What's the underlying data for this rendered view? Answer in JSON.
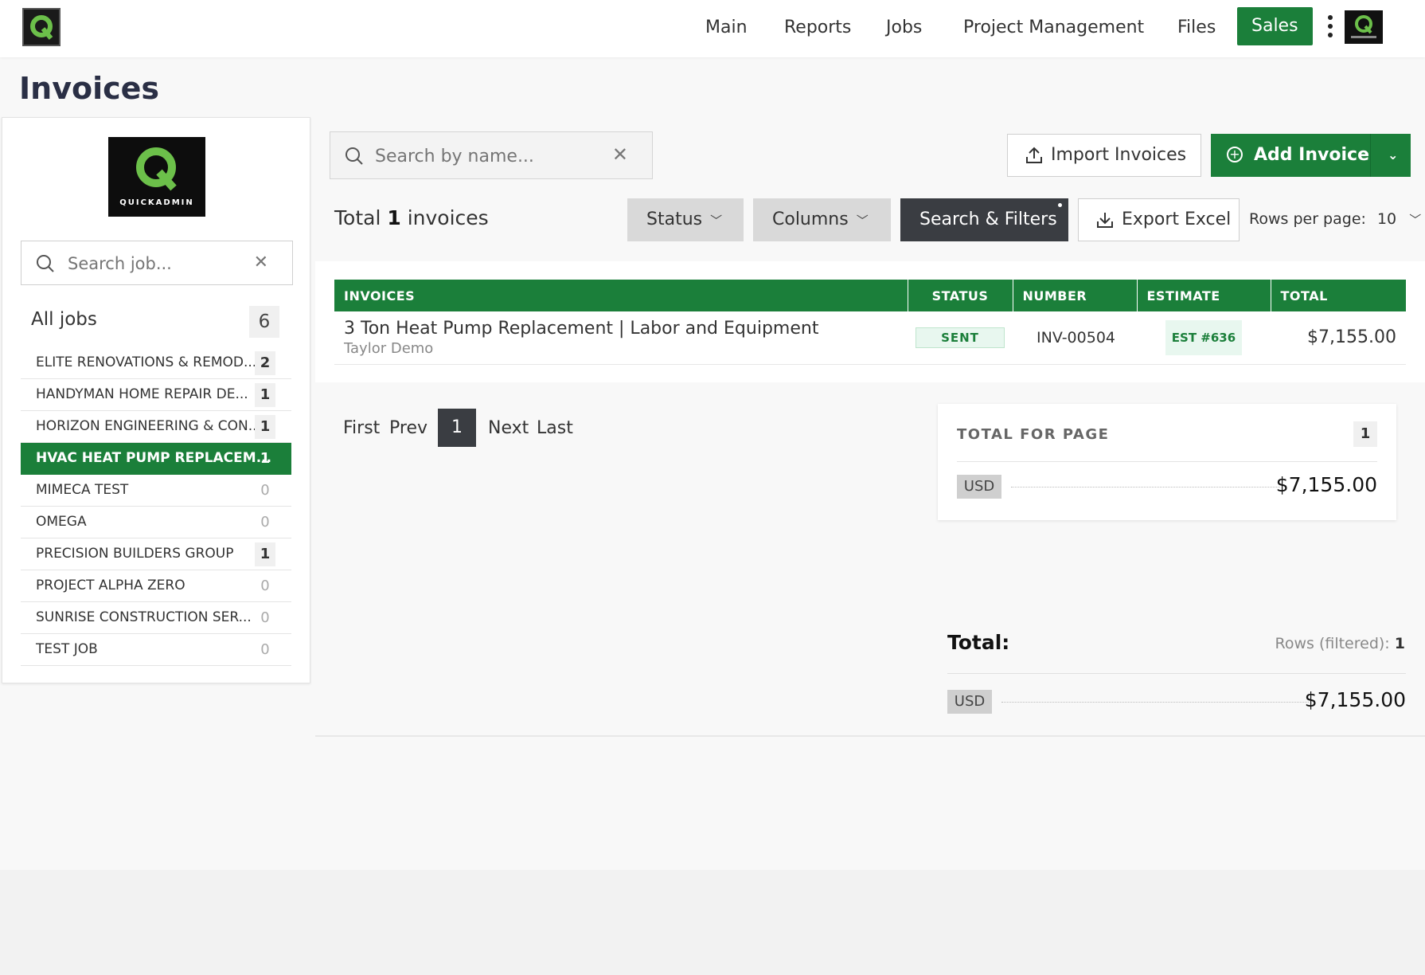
{
  "nav": {
    "items": [
      "Main",
      "Reports",
      "Jobs",
      "Project Management",
      "Files"
    ],
    "sales": "Sales"
  },
  "brand": {
    "name": "QUICKADMIN",
    "accent": "#1b7f3a",
    "logo_green": "#6cc04a"
  },
  "page_title": "Invoices",
  "sidebar": {
    "search_placeholder": "Search job...",
    "all_jobs_label": "All jobs",
    "all_jobs_count": "6",
    "jobs": [
      {
        "name": "ELITE RENOVATIONS & REMOD...",
        "count": "2"
      },
      {
        "name": "HANDYMAN HOME REPAIR DE...",
        "count": "1"
      },
      {
        "name": "HORIZON ENGINEERING & CON...",
        "count": "1"
      },
      {
        "name": "HVAC HEAT PUMP REPLACEM...",
        "count": "1"
      },
      {
        "name": "MIMECA TEST",
        "count": "0"
      },
      {
        "name": "OMEGA",
        "count": "0"
      },
      {
        "name": "PRECISION BUILDERS GROUP",
        "count": "1"
      },
      {
        "name": "PROJECT ALPHA ZERO",
        "count": "0"
      },
      {
        "name": "SUNRISE CONSTRUCTION SER...",
        "count": "0"
      },
      {
        "name": "TEST JOB",
        "count": "0"
      }
    ],
    "active_job": "HVAC HEAT PUMP REPLACEM..."
  },
  "toolbar": {
    "search_placeholder": "Search by name...",
    "import_label": "Import Invoices",
    "add_label": "Add Invoice",
    "total_prefix": "Total",
    "total_count": "1",
    "total_suffix": "invoices",
    "status_label": "Status",
    "columns_label": "Columns",
    "filters_label": "Search & Filters",
    "export_label": "Export Excel",
    "rows_per_page_label": "Rows per page:",
    "rows_per_page_value": "10"
  },
  "table": {
    "headers": [
      "INVOICES",
      "STATUS",
      "NUMBER",
      "ESTIMATE",
      "TOTAL"
    ],
    "rows": [
      {
        "title": "3 Ton Heat Pump Replacement | Labor and Equipment",
        "client": "Taylor Demo",
        "status": "SENT",
        "number": "INV-00504",
        "estimate": "EST #636",
        "total": "$7,155.00"
      }
    ]
  },
  "pager": {
    "first": "First",
    "prev": "Prev",
    "current": "1",
    "next": "Next",
    "last": "Last"
  },
  "page_totals": {
    "label": "TOTAL FOR PAGE",
    "count": "1",
    "currency": "USD",
    "amount": "$7,155.00"
  },
  "grand_totals": {
    "label": "Total:",
    "rows_label": "Rows (filtered):",
    "rows_count": "1",
    "currency": "USD",
    "amount": "$7,155.00"
  }
}
